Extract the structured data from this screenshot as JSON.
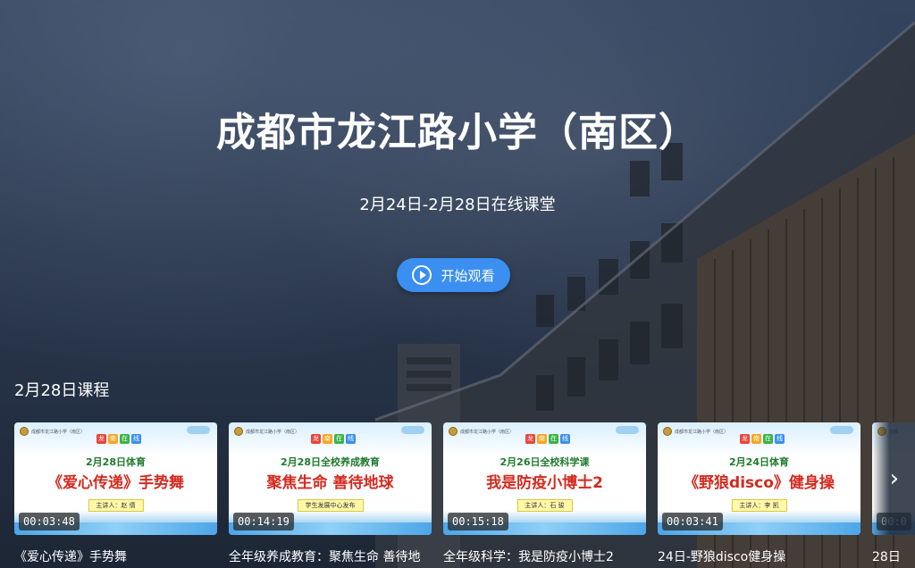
{
  "hero": {
    "title": "成都市龙江路小学（南区）",
    "subtitle": "2月24日-2月28日在线课堂",
    "watch_label": "开始观看"
  },
  "section": {
    "heading": "2月28日课程"
  },
  "thumb_logo_chars": [
    "龙",
    "南",
    "在",
    "线"
  ],
  "cards": [
    {
      "title": "《爱心传递》手势舞",
      "duration": "00:03:48",
      "thumb_line1": "2月28日体育",
      "thumb_line2": "《爱心传递》手势舞",
      "thumb_presenter": "主讲人：赵 倩",
      "thumb_school": "成都市龙江路小学（南区）"
    },
    {
      "title": "全年级养成教育：聚焦生命 善待地",
      "duration": "00:14:19",
      "thumb_line1": "2月28日全校养成教育",
      "thumb_line2": "聚焦生命  善待地球",
      "thumb_presenter": "学生发展中心发布",
      "thumb_school": "成都市龙江路小学（南区）"
    },
    {
      "title": "全年级科学：我是防疫小博士2",
      "duration": "00:15:18",
      "thumb_line1": "2月26日全校科学课",
      "thumb_line2": "我是防疫小博士2",
      "thumb_presenter": "主讲人：石 骏",
      "thumb_school": "成都市龙江路小学（南区）"
    },
    {
      "title": "24日-野狼disco健身操",
      "duration": "00:03:41",
      "thumb_line1": "2月24日体育",
      "thumb_line2": "《野狼disco》健身操",
      "thumb_presenter": "主讲人：李 凯",
      "thumb_school": "成都市龙江路小学（南区）"
    },
    {
      "title": "28日",
      "duration": "00:0",
      "thumb_line1": "",
      "thumb_line2": "",
      "thumb_presenter": "",
      "thumb_school": "成都"
    }
  ],
  "colors": {
    "accent_button": "#3a8ff0",
    "thumb_green": "#1f7a2e",
    "thumb_red": "#d42a1f"
  },
  "icons": {
    "play": "play-circle-icon",
    "next": "chevron-right-icon"
  }
}
